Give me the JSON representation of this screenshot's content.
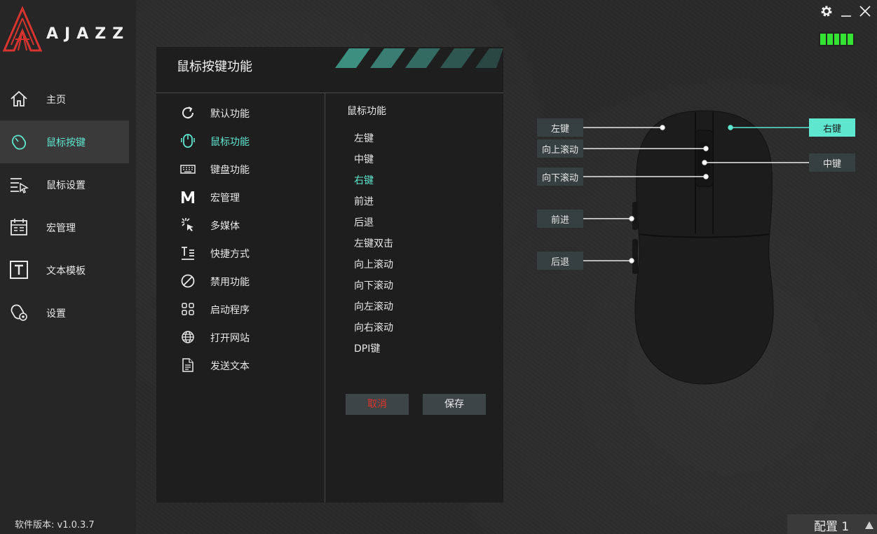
{
  "brand": {
    "name": "AJAZZ"
  },
  "sidebar": {
    "items": [
      {
        "label": "主页",
        "icon": "home-icon"
      },
      {
        "label": "鼠标按键",
        "icon": "mouse-icon",
        "active": true
      },
      {
        "label": "鼠标设置",
        "icon": "mouse-settings-icon"
      },
      {
        "label": "宏管理",
        "icon": "macro-icon"
      },
      {
        "label": "文本模板",
        "icon": "text-template-icon"
      },
      {
        "label": "设置",
        "icon": "settings-icon"
      }
    ],
    "version": "软件版本: v1.0.3.7"
  },
  "panel": {
    "title": "鼠标按键功能",
    "categories": [
      {
        "label": "默认功能",
        "icon": "refresh-icon"
      },
      {
        "label": "鼠标功能",
        "icon": "mouse-icon",
        "active": true
      },
      {
        "label": "键盘功能",
        "icon": "keyboard-icon"
      },
      {
        "label": "宏管理",
        "icon": "macro-m-icon"
      },
      {
        "label": "多媒体",
        "icon": "multimedia-icon"
      },
      {
        "label": "快捷方式",
        "icon": "shortcut-icon"
      },
      {
        "label": "禁用功能",
        "icon": "disable-icon"
      },
      {
        "label": "启动程序",
        "icon": "apps-grid-icon"
      },
      {
        "label": "打开网站",
        "icon": "globe-icon"
      },
      {
        "label": "发送文本",
        "icon": "document-icon"
      }
    ],
    "sub_title": "鼠标功能",
    "sub_items": [
      {
        "label": "左键"
      },
      {
        "label": "中键"
      },
      {
        "label": "右键",
        "active": true
      },
      {
        "label": "前进"
      },
      {
        "label": "后退"
      },
      {
        "label": "左键双击"
      },
      {
        "label": "向上滚动"
      },
      {
        "label": "向下滚动"
      },
      {
        "label": "向左滚动"
      },
      {
        "label": "向右滚动"
      },
      {
        "label": "DPI键"
      }
    ],
    "cancel_label": "取消",
    "save_label": "保存"
  },
  "mouse_labels": {
    "left": "左键",
    "scroll_up": "向上滚动",
    "scroll_down": "向下滚动",
    "forward": "前进",
    "back": "后退",
    "right": "右键",
    "middle": "中键"
  },
  "profile": {
    "label": "配置 1"
  },
  "colors": {
    "accent": "#5fe6cf",
    "battery": "#33e233",
    "cancel": "#e0332b"
  }
}
